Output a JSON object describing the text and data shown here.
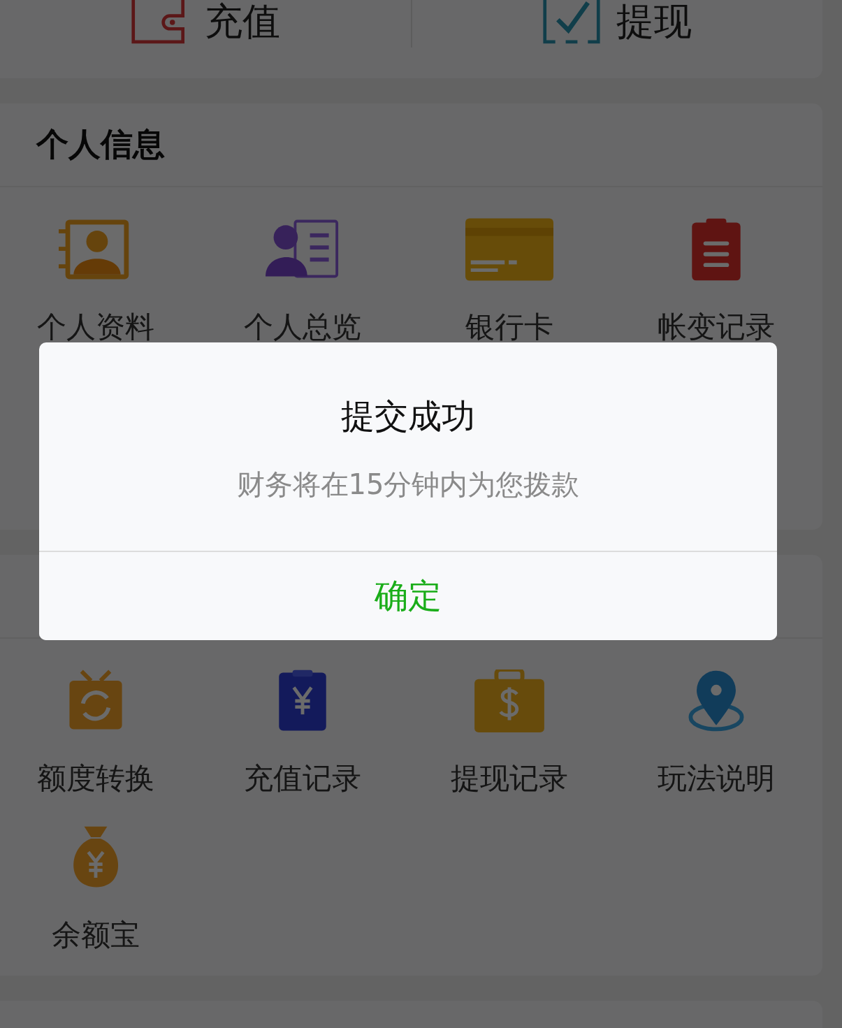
{
  "wallet_actions": [
    {
      "label": "充值",
      "kind": "wallet"
    },
    {
      "label": "提现",
      "kind": "check"
    }
  ],
  "sections": [
    {
      "title": "个人信息",
      "items": [
        {
          "label": "个人资料",
          "kind": "contact"
        },
        {
          "label": "个人总览",
          "kind": "profile"
        },
        {
          "label": "银行卡",
          "kind": "card"
        },
        {
          "label": "帐变记录",
          "kind": "clipboard"
        }
      ]
    },
    {
      "items": [
        {
          "label": "额度转换",
          "kind": "exchange"
        },
        {
          "label": "充值记录",
          "kind": "yen"
        },
        {
          "label": "提现记录",
          "kind": "dollar"
        },
        {
          "label": "玩法说明",
          "kind": "pin"
        },
        {
          "label": "余额宝",
          "kind": "bag"
        }
      ]
    }
  ],
  "dialog": {
    "title": "提交成功",
    "message": "财务将在15分钟内为您拨款",
    "button": "确定"
  }
}
